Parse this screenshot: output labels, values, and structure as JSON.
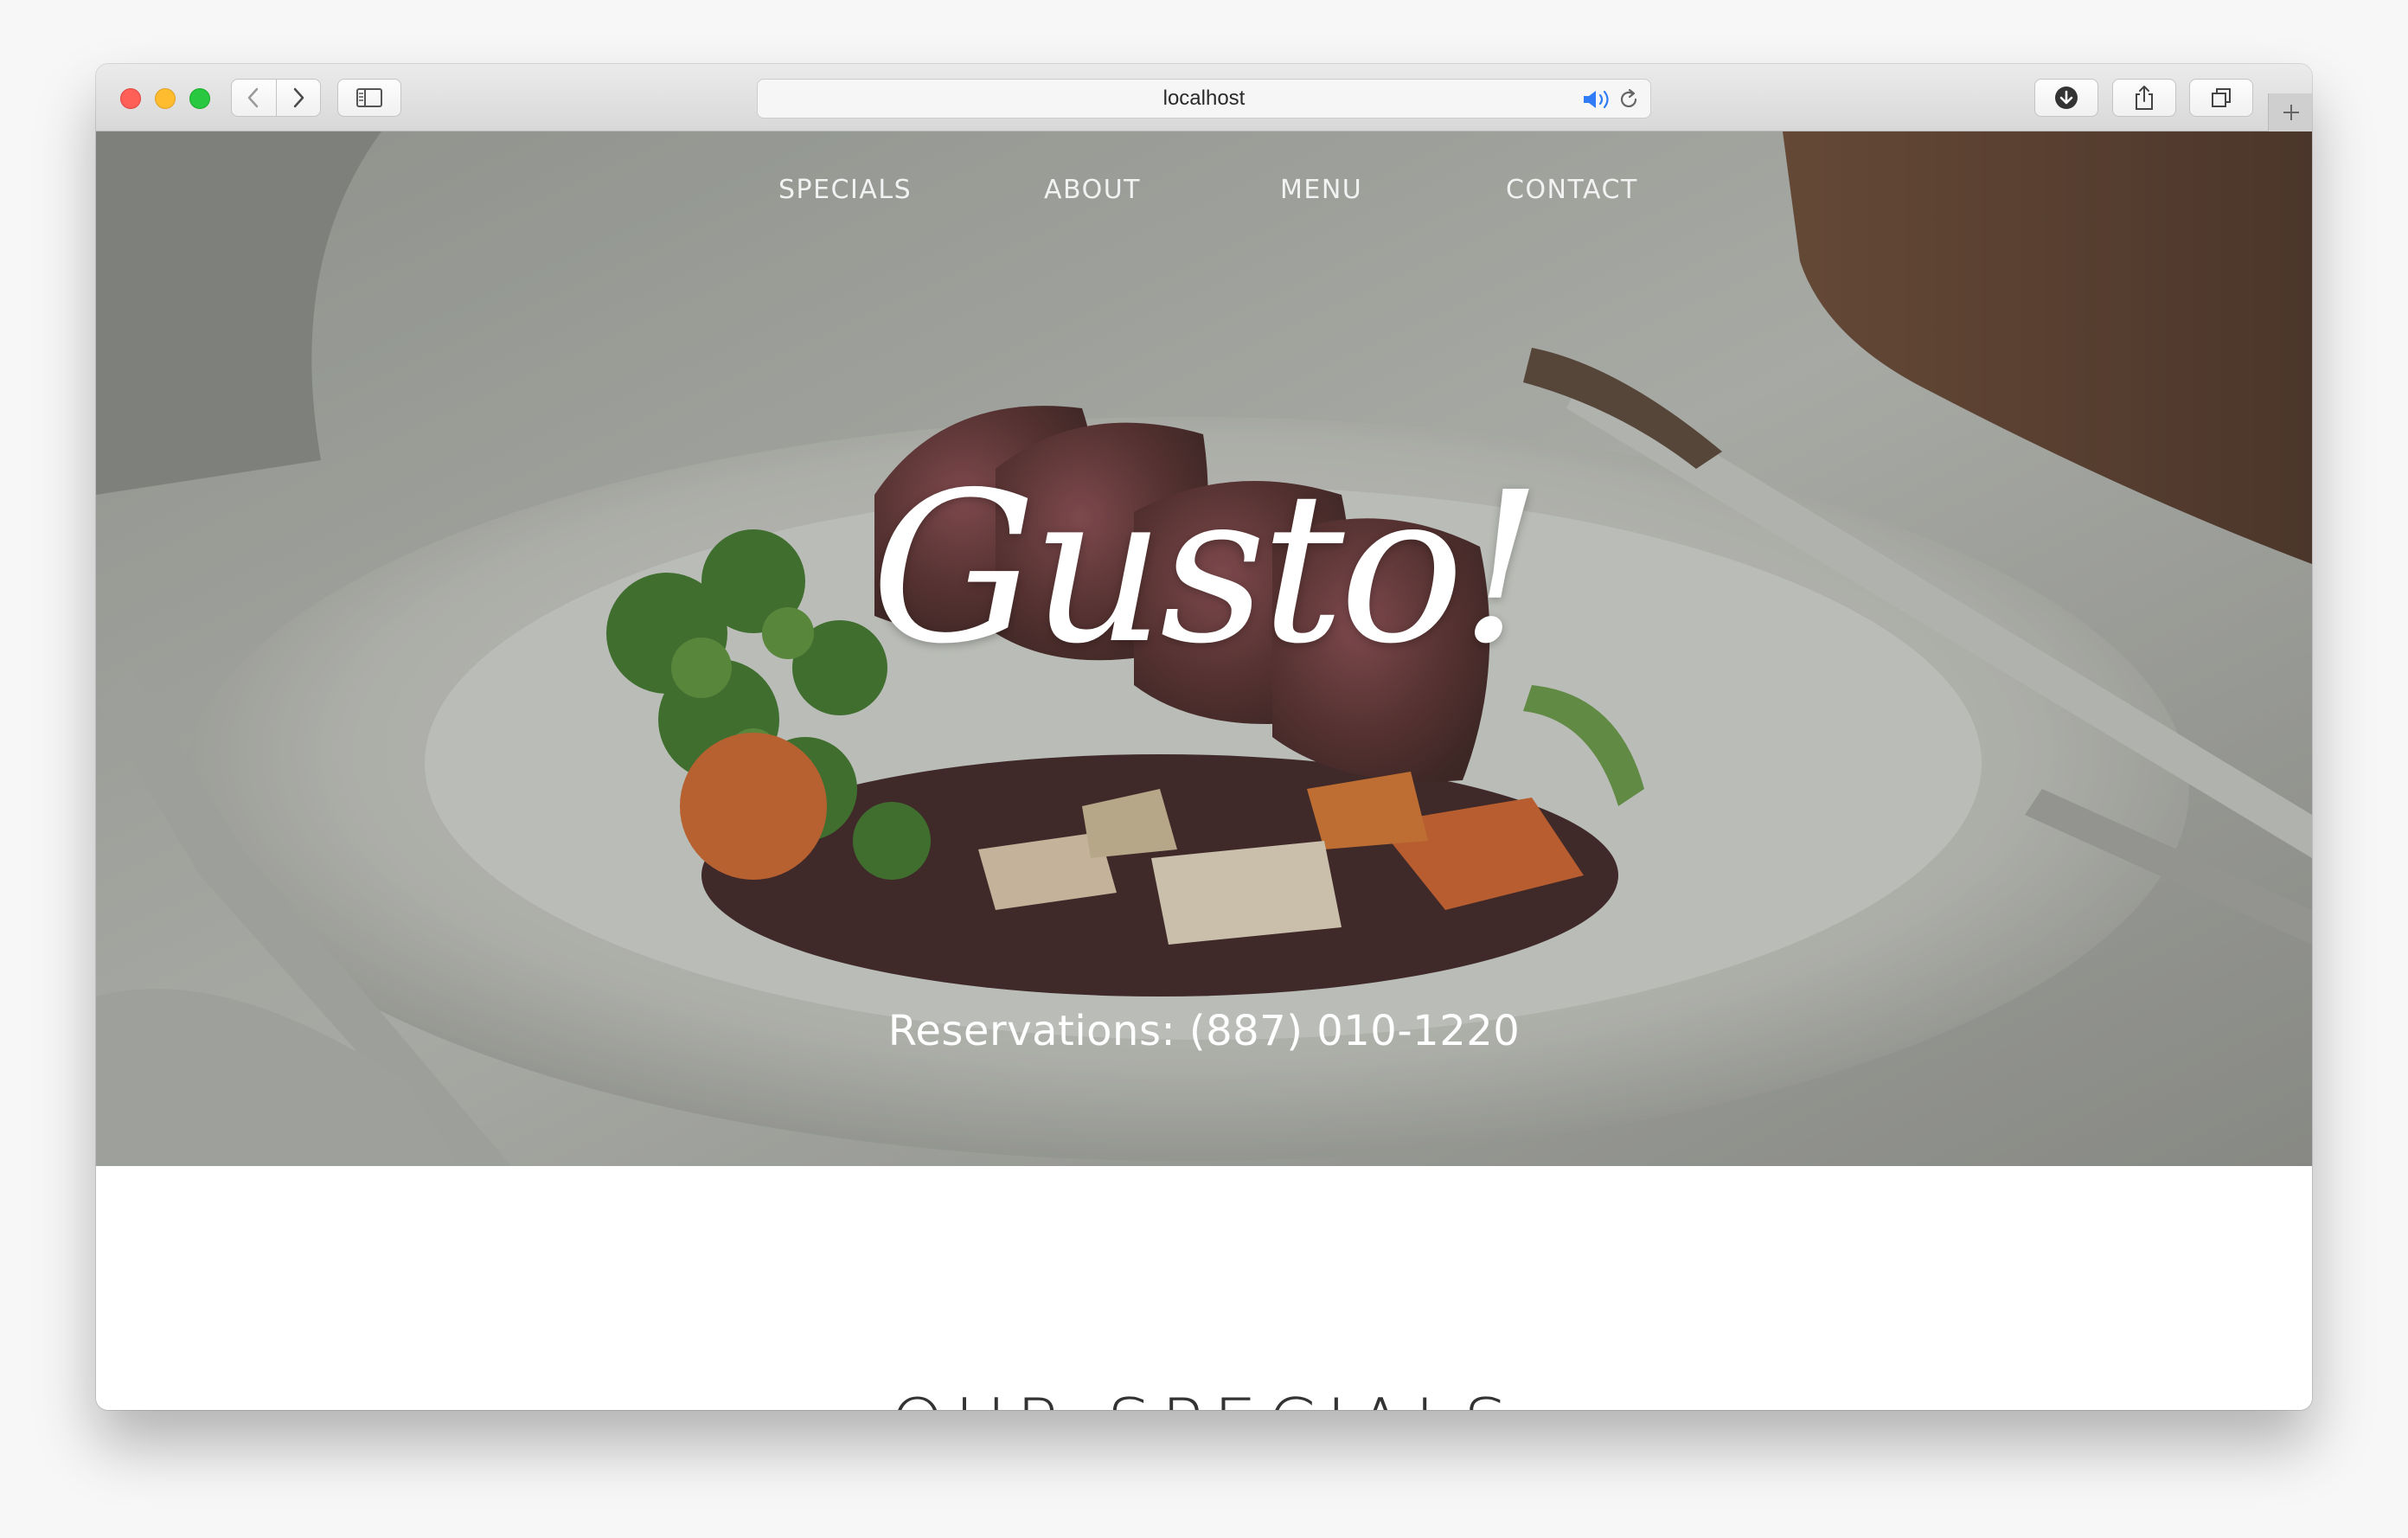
{
  "browser": {
    "address": "localhost",
    "icons": {
      "back": "chevron-left-icon",
      "forward": "chevron-right-icon",
      "sidebar": "sidebar-icon",
      "audio": "speaker-icon",
      "reload": "reload-icon",
      "download": "download-icon",
      "share": "share-icon",
      "tabs": "tabs-icon",
      "new_tab": "plus-icon"
    },
    "accent_color": "#2f7cf6"
  },
  "site": {
    "nav": [
      {
        "label": "SPECIALS"
      },
      {
        "label": "ABOUT"
      },
      {
        "label": "MENU"
      },
      {
        "label": "CONTACT"
      }
    ],
    "brand": "Gusto!",
    "reservations": "Reservations: (887) 010-1220",
    "section_heading": "OUR SPECIALS"
  }
}
